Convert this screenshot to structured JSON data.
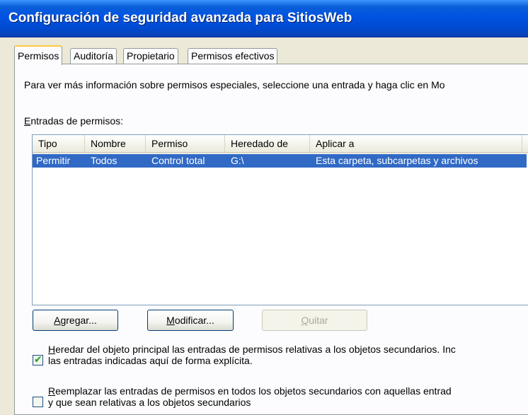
{
  "window": {
    "title": "Configuración de seguridad avanzada para SitiosWeb"
  },
  "tabs": [
    {
      "label": "Permisos",
      "active": true
    },
    {
      "label": "Auditoría",
      "active": false
    },
    {
      "label": "Propietario",
      "active": false
    },
    {
      "label": "Permisos efectivos",
      "active": false
    }
  ],
  "info_text": "Para ver más información sobre permisos especiales, seleccione una entrada y haga clic en Mo",
  "entries_label": {
    "mnemonic": "E",
    "rest": "ntradas de permisos:"
  },
  "table": {
    "columns": [
      "Tipo",
      "Nombre",
      "Permiso",
      "Heredado de",
      "Aplicar a"
    ],
    "rows": [
      [
        "Permitir",
        "Todos",
        "Control total",
        "G:\\",
        "Esta carpeta, subcarpetas y archivos"
      ]
    ],
    "selected_row": 0
  },
  "buttons": {
    "add": {
      "mnemonic": "A",
      "rest": "gregar...",
      "enabled": true
    },
    "edit": {
      "mnemonic": "M",
      "rest": "odificar...",
      "enabled": true
    },
    "remove": {
      "mnemonic": "Q",
      "rest": "uitar",
      "enabled": false
    }
  },
  "checkboxes": [
    {
      "mnemonic": "H",
      "line1_rest": "eredar del objeto principal las entradas de permisos relativas a los objetos secundarios. Inc",
      "line2": "las entradas indicadas aquí de forma explícita.",
      "checked": true
    },
    {
      "mnemonic": "R",
      "line1_rest": "eemplazar las entradas de permisos en todos los objetos secundarios con aquellas entrad",
      "line2": "y que sean relativas a los objetos secundarios",
      "checked": false
    }
  ],
  "colors": {
    "titlebar": "#0053e1",
    "selection": "#316ac5",
    "tab_highlight": "#ffc83c"
  }
}
